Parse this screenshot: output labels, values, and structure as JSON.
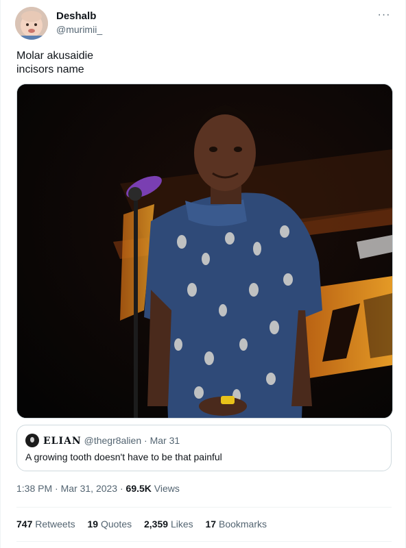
{
  "author": {
    "name": "Deshalb",
    "handle": "@murimii_"
  },
  "more_icon": "more-horizontal-icon",
  "tweet": {
    "text": "Molar akusaidie\nincisors name"
  },
  "media": {
    "kind": "photo",
    "description_colors": {
      "background": "#060606",
      "shirt": "#2f4a78",
      "banner": "#e59a23"
    }
  },
  "quote": {
    "name": "ELIAN",
    "handle": "@thegr8alien",
    "separator": "·",
    "date": "Mar 31",
    "text": "A growing tooth doesn't have to be that painful"
  },
  "meta": {
    "time": "1:38 PM",
    "separator1": "·",
    "date": "Mar 31, 2023",
    "separator2": "·",
    "views_count": "69.5K",
    "views_label": "Views"
  },
  "stats": {
    "retweets": {
      "count": "747",
      "label": "Retweets"
    },
    "quotes": {
      "count": "19",
      "label": "Quotes"
    },
    "likes": {
      "count": "2,359",
      "label": "Likes"
    },
    "bookmarks": {
      "count": "17",
      "label": "Bookmarks"
    }
  },
  "colors": {
    "text_primary": "#0f1419",
    "text_secondary": "#536471",
    "border": "#cfd9de",
    "divider": "#eff3f4"
  }
}
